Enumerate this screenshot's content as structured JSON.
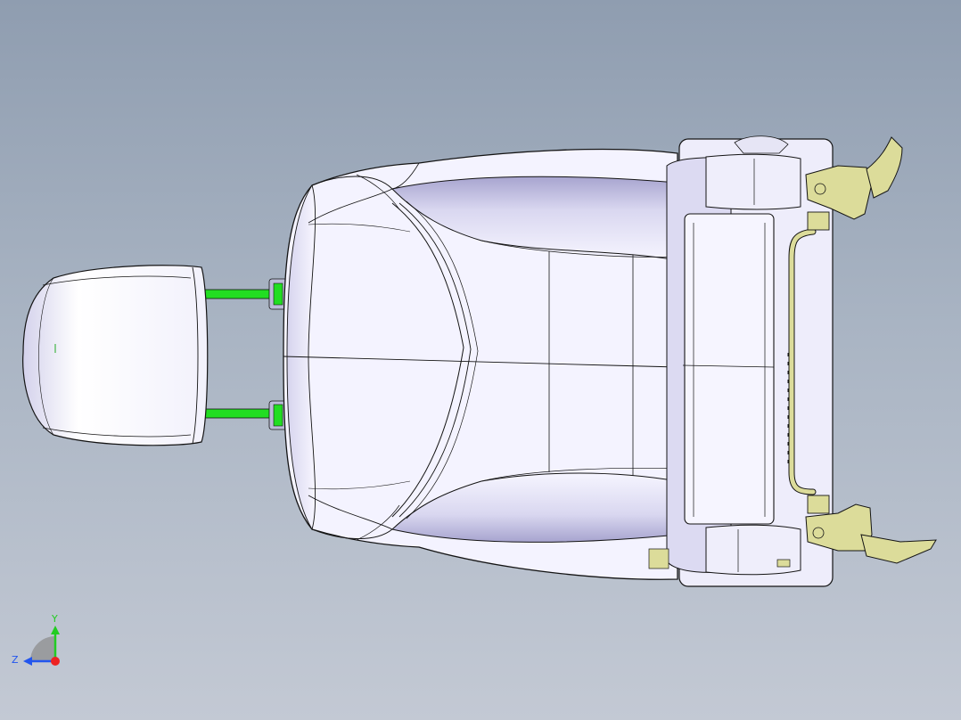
{
  "viewport": {
    "background_top": "#8f9db0",
    "background_bottom": "#c3c9d4"
  },
  "model": {
    "shell_fill": "#f4f3ff",
    "shadow_fill": "#b9b7da",
    "edge_color": "#141414",
    "post_color": "#22dd22",
    "hardware_color": "#dcdc9a"
  },
  "triad": {
    "y_label": "Y",
    "z_label": "Z",
    "y_color": "#22cc22",
    "z_color": "#2255ee",
    "x_color": "#ee2222"
  }
}
